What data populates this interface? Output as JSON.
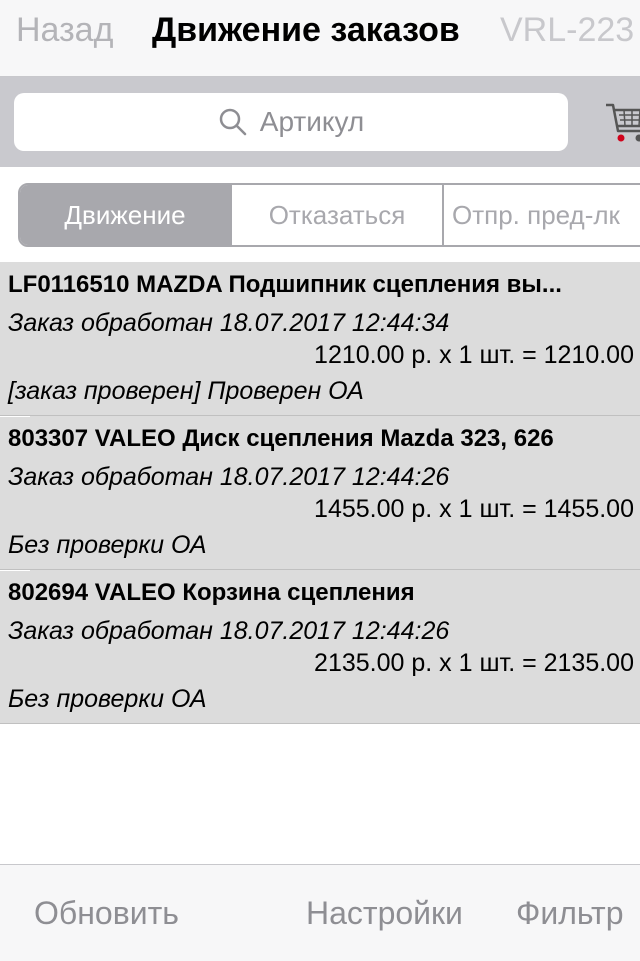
{
  "navbar": {
    "back_label": "Назад",
    "title": "Движение заказов",
    "right_label": "VRL-223"
  },
  "search": {
    "placeholder": "Артикул",
    "icon": "search-icon",
    "cart_icon": "cart-icon",
    "cart_accent": "#d0021b"
  },
  "segments": [
    {
      "label": "Движение",
      "active": true
    },
    {
      "label": "Отказаться",
      "active": false
    },
    {
      "label": "Отпр. пред-лк",
      "active": false
    }
  ],
  "orders": [
    {
      "title": "LF0116510 MAZDA Подшипник сцепления вы...",
      "status": "Заказ обработан 18.07.2017 12:44:34",
      "price_line": "1210.00 р. x 1 шт. =  1210.00",
      "check": "[заказ проверен] Проверен ОА"
    },
    {
      "title": "803307 VALEO Диск сцепления Mazda 323, 626",
      "status": "Заказ обработан 18.07.2017 12:44:26",
      "price_line": "1455.00 р. x 1 шт. =  1455.00",
      "check": "Без проверки ОА"
    },
    {
      "title": "802694 VALEO Корзина сцепления",
      "status": "Заказ обработан 18.07.2017 12:44:26",
      "price_line": "2135.00 р. x 1 шт. =  2135.00",
      "check": "Без проверки ОА"
    }
  ],
  "toolbar": {
    "refresh_label": "Обновить",
    "settings_label": "Настройки",
    "filter_label": "Фильтр"
  },
  "colors": {
    "row_background": "#dcdcdc",
    "segment_active": "#a8a8ad",
    "muted_text": "#8e8e93"
  }
}
